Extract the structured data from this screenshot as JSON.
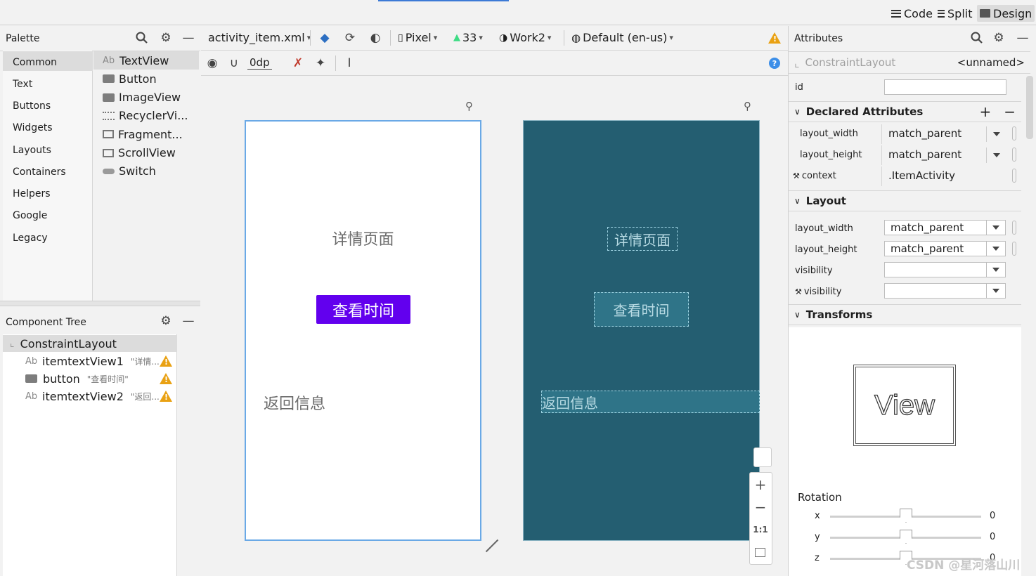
{
  "modebar": {
    "code": "Code",
    "split": "Split",
    "design": "Design"
  },
  "palette": {
    "title": "Palette",
    "categories": [
      "Common",
      "Text",
      "Buttons",
      "Widgets",
      "Layouts",
      "Containers",
      "Helpers",
      "Google",
      "Legacy"
    ],
    "items": [
      "TextView",
      "Button",
      "ImageView",
      "RecyclerVi...",
      "Fragment...",
      "ScrollView",
      "Switch"
    ]
  },
  "component_tree": {
    "title": "Component Tree",
    "root": "ConstraintLayout",
    "rows": [
      {
        "name": "itemtextView1",
        "hint": "\"详情...",
        "icon": "Ab"
      },
      {
        "name": "button",
        "hint": "\"查看时间\"",
        "icon": "button"
      },
      {
        "name": "itemtextView2",
        "hint": "\"返回...",
        "icon": "Ab"
      }
    ]
  },
  "toolbar": {
    "file": "activity_item.xml",
    "device": "Pixel",
    "api": "33",
    "theme": "Work2",
    "locale": "Default (en-us)",
    "margin": "0dp"
  },
  "design": {
    "title_text": "详情页面",
    "button_text": "查看时间",
    "back_text": "返回信息"
  },
  "zoom": {
    "plus": "+",
    "minus": "−",
    "ratio": "1:1"
  },
  "attributes": {
    "title": "Attributes",
    "component": "ConstraintLayout",
    "component_name": "<unnamed>",
    "id_label": "id",
    "declared_title": "Declared Attributes",
    "declared": [
      {
        "label": "layout_width",
        "value": "match_parent"
      },
      {
        "label": "layout_height",
        "value": "match_parent"
      },
      {
        "label": "context",
        "value": ".ItemActivity"
      }
    ],
    "layout_title": "Layout",
    "layout": [
      {
        "label": "layout_width",
        "value": "match_parent"
      },
      {
        "label": "layout_height",
        "value": "match_parent"
      },
      {
        "label": "visibility",
        "value": ""
      },
      {
        "label": "visibility",
        "value": ""
      }
    ],
    "transforms_title": "Transforms",
    "view_label": "View",
    "rotation_title": "Rotation",
    "rotation": [
      {
        "axis": "x",
        "value": "0"
      },
      {
        "axis": "y",
        "value": "0"
      },
      {
        "axis": "z",
        "value": "0"
      }
    ]
  },
  "watermark": "CSDN @星河落山川",
  "colors": {
    "accent_purple": "#6200ee",
    "blueprint": "#245e71",
    "selection": "#6aa9e6",
    "warning": "#e9a113"
  }
}
